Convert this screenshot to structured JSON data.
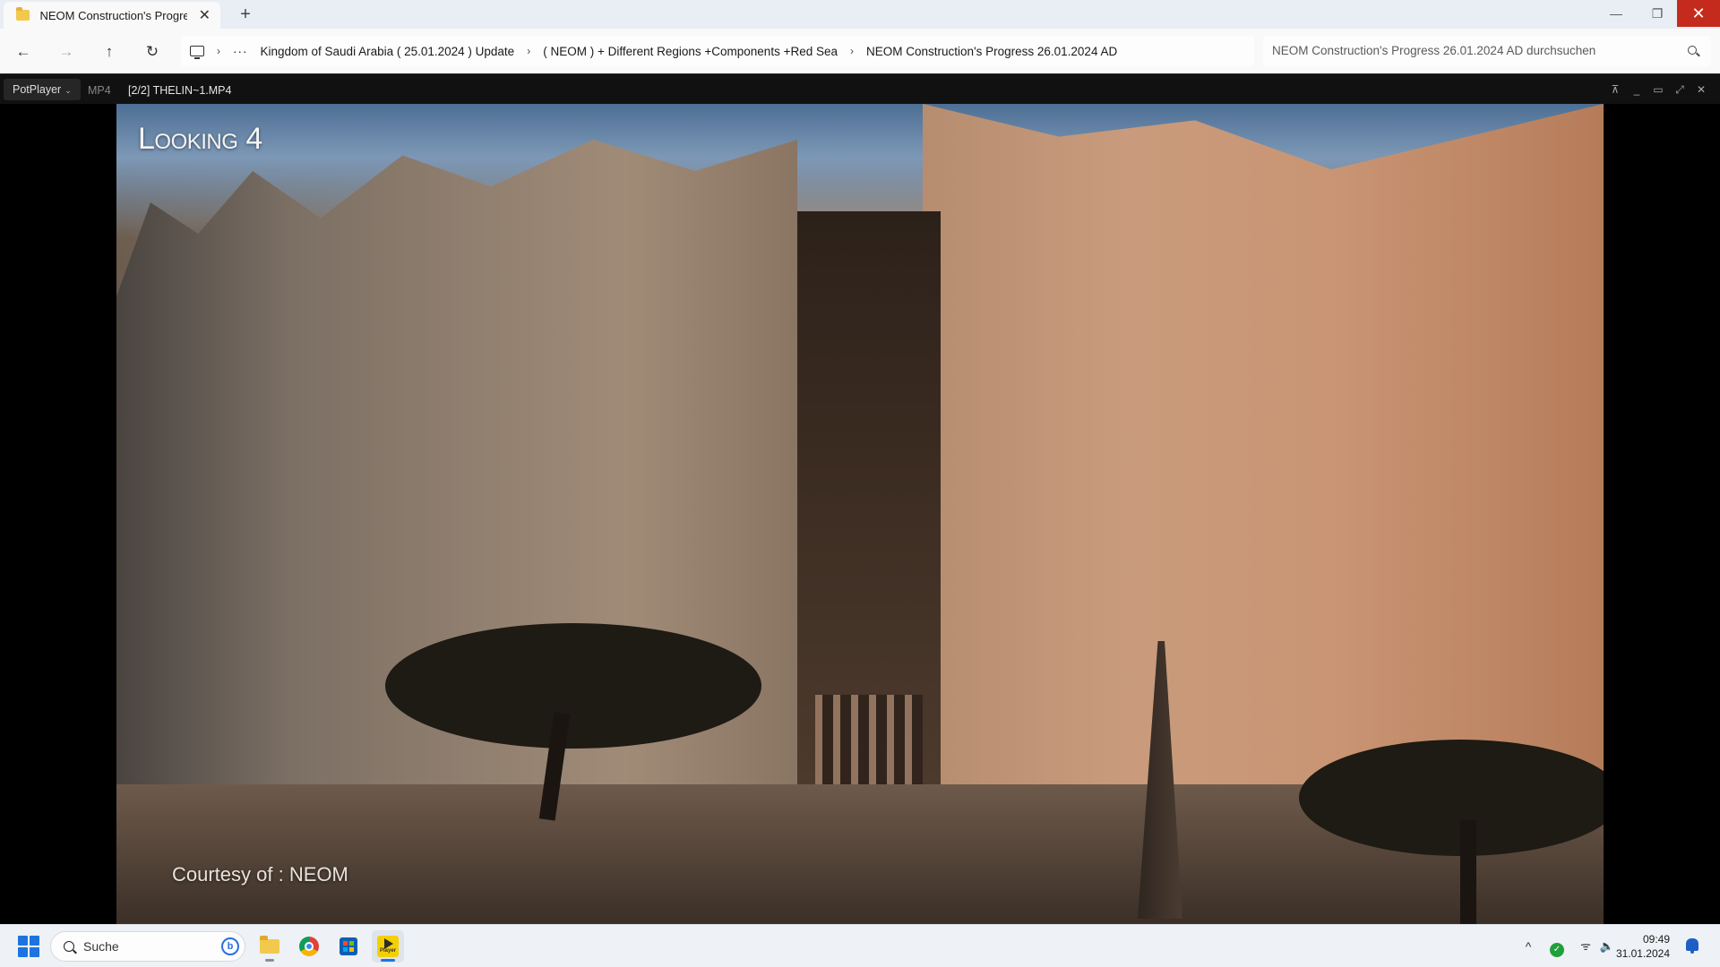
{
  "explorer": {
    "tab_title": "NEOM Construction's Progress",
    "tab_close": "✕",
    "new_tab": "+",
    "window_controls": {
      "minimize": "—",
      "maximize": "❐",
      "close": "✕"
    },
    "nav": {
      "back": "←",
      "forward": "→",
      "up": "↑",
      "refresh": "↻"
    },
    "breadcrumb": {
      "dots": "···",
      "items": [
        "Kingdom of Saudi Arabia ( 25.01.2024 ) Update",
        "( NEOM ) + Different Regions +Components +Red Sea",
        "NEOM Construction's Progress 26.01.2024 AD"
      ],
      "separator": "›"
    },
    "search_placeholder": "NEOM Construction's Progress 26.01.2024 AD durchsuchen"
  },
  "player": {
    "menu_label": "PotPlayer",
    "menu_chevron": "⌄",
    "format": "MP4",
    "file": "[2/2] THELIN~1.MP4",
    "controls": {
      "pin": "⊼",
      "minimize": "_",
      "maximize": "▭",
      "fullscreen": "⤢",
      "close": "✕"
    },
    "video": {
      "overlay_title": "Looking 4",
      "overlay_credit": "Courtesy of : NEOM"
    }
  },
  "taskbar": {
    "search_label": "Suche",
    "bing_label": "b",
    "pot_label": "Player",
    "tray": {
      "chevron": "^",
      "check": "✓",
      "wifi": "ᯤ",
      "volume": "🔈"
    },
    "time": "09:49",
    "date": "31.01.2024"
  },
  "colors": {
    "close_red": "#c42b1c",
    "accent_blue": "#1d74e0",
    "player_bar": "#111111"
  }
}
